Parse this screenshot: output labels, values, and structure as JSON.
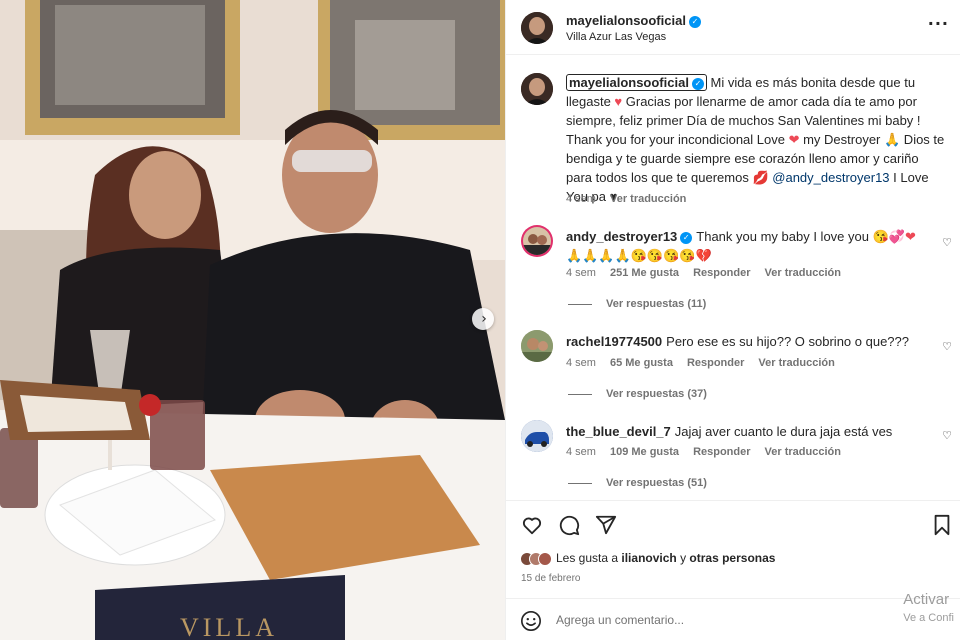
{
  "post": {
    "username": "mayelialonsooficial",
    "location": "Villa Azur Las Vegas",
    "verified_icon": "verified-badge-icon",
    "more_icon": "more-options-icon"
  },
  "caption": {
    "username": "mayelialonsooficial",
    "text_1": " Mi vida es más bonita desde que tu llegaste ",
    "text_2": " Gracias por llenarme de amor cada día te amo por siempre, feliz primer Día de muchos San Valentines mi baby ! Thank you for your incondicional Love ",
    "text_3": " my Destroyer ",
    "text_4": " Dios te bendiga y te guarde siempre ese corazón lleno amor y cariño para todos los que te queremos ",
    "mention": "@andy_destroyer13",
    "text_5": " I Love You pa ",
    "time": "4 sem",
    "translate": "Ver traducción"
  },
  "comments": [
    {
      "username": "andy_destroyer13",
      "verified": true,
      "text": "Thank you my baby I love you ",
      "time": "4 sem",
      "likes": "251 Me gusta",
      "reply": "Responder",
      "translate": "Ver traducción",
      "replies": "Ver respuestas (11)"
    },
    {
      "username": "rachel19774500",
      "verified": false,
      "text": "Pero ese es su hijo?? O sobrino o que???",
      "time": "4 sem",
      "likes": "65 Me gusta",
      "reply": "Responder",
      "translate": "Ver traducción",
      "replies": "Ver respuestas (37)"
    },
    {
      "username": "the_blue_devil_7",
      "verified": false,
      "text": "Jajaj aver cuanto le dura jaja está ves",
      "time": "4 sem",
      "likes": "109 Me gusta",
      "reply": "Responder",
      "translate": "Ver traducción",
      "replies": "Ver respuestas (51)"
    }
  ],
  "actions": {
    "like_icon": "heart-icon",
    "comment_icon": "comment-icon",
    "share_icon": "share-icon",
    "save_icon": "bookmark-icon"
  },
  "likes_summary": {
    "prefix": "Les gusta a ",
    "user": "ilianovich",
    "suffix": " y ",
    "others": "otras personas"
  },
  "date": "15 de febrero",
  "add_comment": {
    "placeholder": "Agrega un comentario..."
  },
  "watermark": {
    "line1": "Activar",
    "line2": "Ve a Confi"
  },
  "photo": {
    "menu_text": "VILLA"
  },
  "colors": {
    "verified": "#0095f6",
    "link": "#00376b",
    "heart": "#ed4956",
    "muted": "#737373"
  }
}
